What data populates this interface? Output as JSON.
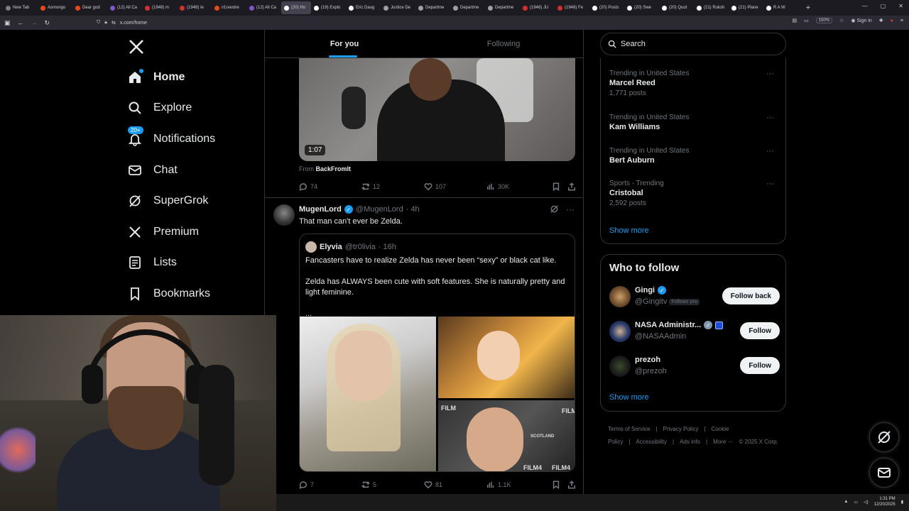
{
  "browser": {
    "tabs": [
      {
        "label": "New Tab",
        "color": "#7c7c8a"
      },
      {
        "label": "Asmongo",
        "color": "#e64a19"
      },
      {
        "label": "Dear god",
        "color": "#e64a19"
      },
      {
        "label": "(12) All Ca",
        "color": "#7e57c2"
      },
      {
        "label": "(1948) m",
        "color": "#d32f2f"
      },
      {
        "label": "(1948) Ie",
        "color": "#d32f2f"
      },
      {
        "label": "r/Livestre",
        "color": "#e64a19"
      },
      {
        "label": "(12) All Ca",
        "color": "#7e57c2"
      },
      {
        "label": "(20) Ho",
        "color": "#ffffff"
      },
      {
        "label": "(19) Explo",
        "color": "#ffffff"
      },
      {
        "label": "Eric Daug",
        "color": "#ffffff"
      },
      {
        "label": "Justice De",
        "color": "#9aa0a6"
      },
      {
        "label": "Departme",
        "color": "#9aa0a6"
      },
      {
        "label": "Departme",
        "color": "#9aa0a6"
      },
      {
        "label": "Departme",
        "color": "#9aa0a6"
      },
      {
        "label": "(1948) JU",
        "color": "#d32f2f"
      },
      {
        "label": "(1948) Fe",
        "color": "#d32f2f"
      },
      {
        "label": "(20) Posts",
        "color": "#ffffff"
      },
      {
        "label": "(20) Swe",
        "color": "#ffffff"
      },
      {
        "label": "(20) Quot",
        "color": "#ffffff"
      },
      {
        "label": "(21) Ruksh",
        "color": "#ffffff"
      },
      {
        "label": "(21) Plane",
        "color": "#ffffff"
      },
      {
        "label": "R A W",
        "color": "#ffffff"
      }
    ],
    "active_tab_index": 8,
    "url": "x.com/home",
    "zoom": "150%",
    "sign_in": "Sign in"
  },
  "nav": {
    "items": [
      {
        "label": "Home",
        "icon": "home-icon"
      },
      {
        "label": "Explore",
        "icon": "search-icon"
      },
      {
        "label": "Notifications",
        "icon": "bell-icon",
        "badge": "20+"
      },
      {
        "label": "Chat",
        "icon": "mail-icon"
      },
      {
        "label": "SuperGrok",
        "icon": "grok-icon"
      },
      {
        "label": "Premium",
        "icon": "x-icon"
      },
      {
        "label": "Lists",
        "icon": "list-icon"
      },
      {
        "label": "Bookmarks",
        "icon": "bookmark-icon"
      }
    ]
  },
  "feed": {
    "tabs": [
      "For you",
      "Following"
    ],
    "video": {
      "duration": "1:07",
      "from_prefix": "From",
      "from_source": "BackFromIt"
    },
    "post1_actions": {
      "replies": "74",
      "reposts": "12",
      "likes": "107",
      "views": "30K"
    },
    "post2": {
      "name": "MugenLord",
      "handle": "@MugenLord",
      "time": "· 4h",
      "text": "That man can't ever be Zelda.",
      "quote": {
        "name": "Elyvia",
        "handle": "@tr0livia",
        "time": "· 16h",
        "para1": "Fancasters have to realize Zelda has never been “sexy” or black cat like.",
        "para2": "Zelda has ALWAYS been cute with soft features. She is naturally pretty and light feminine.",
        "ellipsis": "...",
        "img_labels": [
          "FILM",
          "FILM4",
          "FILM",
          "SCOTLAND",
          "FILM4"
        ]
      },
      "actions": {
        "replies": "7",
        "reposts": "5",
        "likes": "81",
        "views": "1.1K"
      }
    }
  },
  "sidebar": {
    "search_placeholder": "Search",
    "trends": [
      {
        "category": "Trending in United States",
        "title": "Marcel Reed",
        "posts": "1,771 posts"
      },
      {
        "category": "Trending in United States",
        "title": "Kam Williams",
        "posts": ""
      },
      {
        "category": "Trending in United States",
        "title": "Bert Auburn",
        "posts": ""
      },
      {
        "category": "Sports · Trending",
        "title": "Cristobal",
        "posts": "2,592 posts"
      }
    ],
    "show_more": "Show more",
    "who_to_follow": {
      "title": "Who to follow",
      "users": [
        {
          "name": "Gingi",
          "handle": "@Gingitv",
          "follows_you": "Follows you",
          "button": "Follow back"
        },
        {
          "name": "NASA Administr...",
          "handle": "@NASAAdmin",
          "button": "Follow"
        },
        {
          "name": "prezoh",
          "handle": "@prezoh",
          "button": "Follow"
        }
      ],
      "show_more": "Show more"
    },
    "footer": [
      "Terms of Service",
      "|",
      "Privacy Policy",
      "|",
      "Cookie Policy",
      "|",
      "Accessibility",
      "|",
      "Ads info",
      "|",
      "More ···",
      "© 2025 X Corp."
    ]
  },
  "taskbar": {
    "time": "1:31 PM",
    "date": "12/20/2025"
  },
  "colors": {
    "accent": "#1d9bf0",
    "background": "#000000",
    "border": "#2f3336",
    "muted": "#71767b"
  }
}
